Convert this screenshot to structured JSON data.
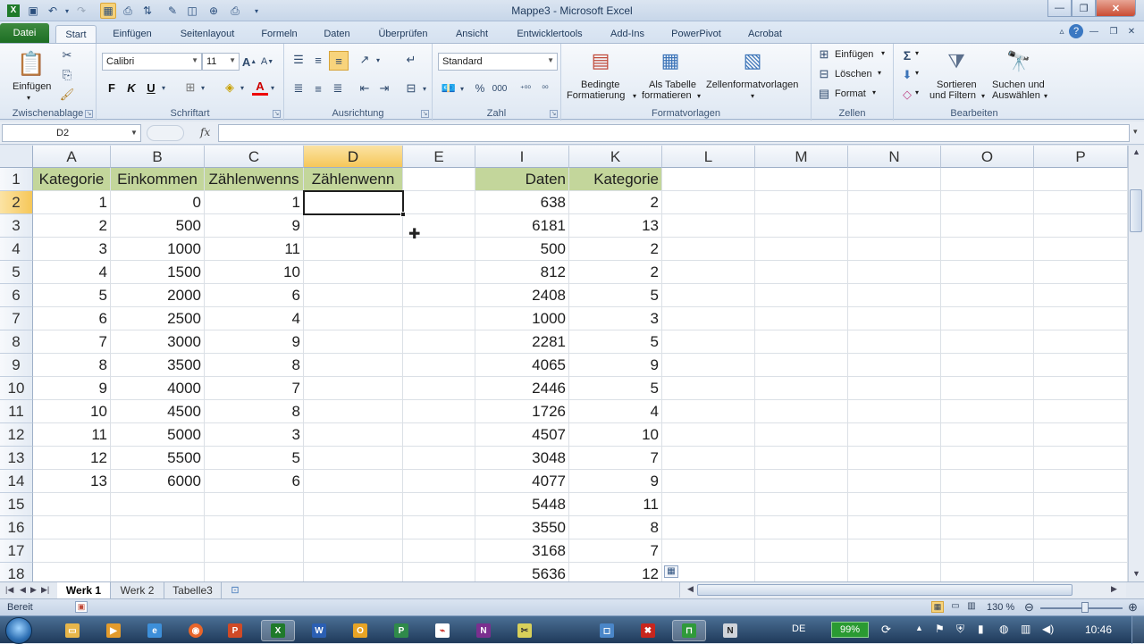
{
  "window": {
    "title": "Mappe3  -  Microsoft Excel"
  },
  "ribbon_tabs": [
    "Datei",
    "Start",
    "Einfügen",
    "Seitenlayout",
    "Formeln",
    "Daten",
    "Überprüfen",
    "Ansicht",
    "Entwicklertools",
    "Add-Ins",
    "PowerPivot",
    "Acrobat"
  ],
  "ribbon": {
    "clipboard": {
      "label": "Zwischenablage",
      "paste": "Einfügen"
    },
    "font": {
      "label": "Schriftart",
      "name": "Calibri",
      "size": "11",
      "bold": "F",
      "italic": "K",
      "underline": "U"
    },
    "alignment": {
      "label": "Ausrichtung"
    },
    "number": {
      "label": "Zahl",
      "format": "Standard",
      "percent": "%",
      "thousands": "000"
    },
    "styles": {
      "label": "Formatvorlagen",
      "conditional_1": "Bedingte",
      "conditional_2": "Formatierung",
      "table_1": "Als Tabelle",
      "table_2": "formatieren",
      "cell_styles": "Zellenformatvorlagen"
    },
    "cells": {
      "label": "Zellen",
      "insert": "Einfügen",
      "delete": "Löschen",
      "format": "Format"
    },
    "editing": {
      "label": "Bearbeiten",
      "sort_1": "Sortieren",
      "sort_2": "und Filtern",
      "find_1": "Suchen und",
      "find_2": "Auswählen",
      "sigma": "Σ"
    }
  },
  "formula_bar": {
    "name_box": "D2",
    "fx": "fx",
    "value": ""
  },
  "grid": {
    "columns": [
      "A",
      "B",
      "C",
      "D",
      "E",
      "I",
      "K",
      "L",
      "M",
      "N",
      "O",
      "P"
    ],
    "selected_column": "D",
    "rows": [
      "1",
      "2",
      "3",
      "4",
      "5",
      "6",
      "7",
      "8",
      "9",
      "10",
      "11",
      "12",
      "13",
      "14",
      "15",
      "16",
      "17",
      "18"
    ],
    "selected_row": "2",
    "headers": {
      "A": "Kategorie",
      "B": "Einkommen",
      "C": "Zählenwenns",
      "D": "Zählenwenn",
      "I": "Daten",
      "K": "Kategorie"
    },
    "table1": [
      [
        "1",
        "0",
        "1"
      ],
      [
        "2",
        "500",
        "9"
      ],
      [
        "3",
        "1000",
        "11"
      ],
      [
        "4",
        "1500",
        "10"
      ],
      [
        "5",
        "2000",
        "6"
      ],
      [
        "6",
        "2500",
        "4"
      ],
      [
        "7",
        "3000",
        "9"
      ],
      [
        "8",
        "3500",
        "8"
      ],
      [
        "9",
        "4000",
        "7"
      ],
      [
        "10",
        "4500",
        "8"
      ],
      [
        "11",
        "5000",
        "3"
      ],
      [
        "12",
        "5500",
        "5"
      ],
      [
        "13",
        "6000",
        "6"
      ]
    ],
    "table2": [
      [
        "638",
        "2"
      ],
      [
        "6181",
        "13"
      ],
      [
        "500",
        "2"
      ],
      [
        "812",
        "2"
      ],
      [
        "2408",
        "5"
      ],
      [
        "1000",
        "3"
      ],
      [
        "2281",
        "5"
      ],
      [
        "4065",
        "9"
      ],
      [
        "2446",
        "5"
      ],
      [
        "1726",
        "4"
      ],
      [
        "4507",
        "10"
      ],
      [
        "3048",
        "7"
      ],
      [
        "4077",
        "9"
      ],
      [
        "5448",
        "11"
      ],
      [
        "3550",
        "8"
      ],
      [
        "3168",
        "7"
      ],
      [
        "5636",
        "12"
      ]
    ]
  },
  "sheet_tabs": [
    "Werk 1",
    "Werk 2",
    "Tabelle3"
  ],
  "status_bar": {
    "mode": "Bereit",
    "zoom": "130 %"
  },
  "taskbar": {
    "language": "DE",
    "battery": "99%",
    "time": "10:46"
  },
  "colors": {
    "header_fill": "#c3d69b",
    "selection_header": "#f6c759",
    "file_tab": "#1d6e24"
  }
}
